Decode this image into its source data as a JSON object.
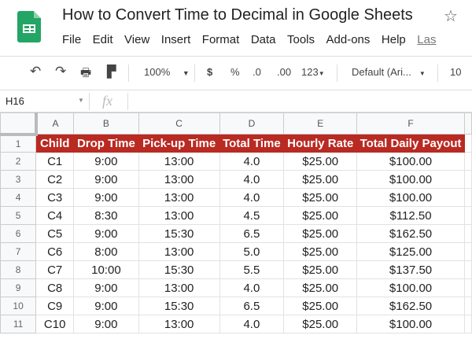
{
  "app": {
    "title": "How to Convert Time to Decimal in Google Sheets"
  },
  "menu": [
    "File",
    "Edit",
    "View",
    "Insert",
    "Format",
    "Data",
    "Tools",
    "Add-ons",
    "Help"
  ],
  "menu_last": "Las",
  "toolbar": {
    "zoom": "100%",
    "currency": "$",
    "percent": "%",
    "dec_less": ".0",
    "dec_more": ".00",
    "format": "123",
    "font": "Default (Ari...",
    "font_size": "10"
  },
  "formula_bar": {
    "cell_ref": "H16",
    "fx": "fx"
  },
  "columns": [
    "A",
    "B",
    "C",
    "D",
    "E",
    "F"
  ],
  "header": [
    "Child",
    "Drop Time",
    "Pick-up Time",
    "Total Time",
    "Hourly Rate",
    "Total Daily Payout"
  ],
  "rows": [
    [
      "C1",
      "9:00",
      "13:00",
      "4.0",
      "$25.00",
      "$100.00"
    ],
    [
      "C2",
      "9:00",
      "13:00",
      "4.0",
      "$25.00",
      "$100.00"
    ],
    [
      "C3",
      "9:00",
      "13:00",
      "4.0",
      "$25.00",
      "$100.00"
    ],
    [
      "C4",
      "8:30",
      "13:00",
      "4.5",
      "$25.00",
      "$112.50"
    ],
    [
      "C5",
      "9:00",
      "15:30",
      "6.5",
      "$25.00",
      "$162.50"
    ],
    [
      "C6",
      "8:00",
      "13:00",
      "5.0",
      "$25.00",
      "$125.00"
    ],
    [
      "C7",
      "10:00",
      "15:30",
      "5.5",
      "$25.00",
      "$137.50"
    ],
    [
      "C8",
      "9:00",
      "13:00",
      "4.0",
      "$25.00",
      "$100.00"
    ],
    [
      "C9",
      "9:00",
      "15:30",
      "6.5",
      "$25.00",
      "$162.50"
    ],
    [
      "C10",
      "9:00",
      "13:00",
      "4.0",
      "$25.00",
      "$100.00"
    ]
  ],
  "row_numbers": [
    "1",
    "2",
    "3",
    "4",
    "5",
    "6",
    "7",
    "8",
    "9",
    "10",
    "11"
  ]
}
